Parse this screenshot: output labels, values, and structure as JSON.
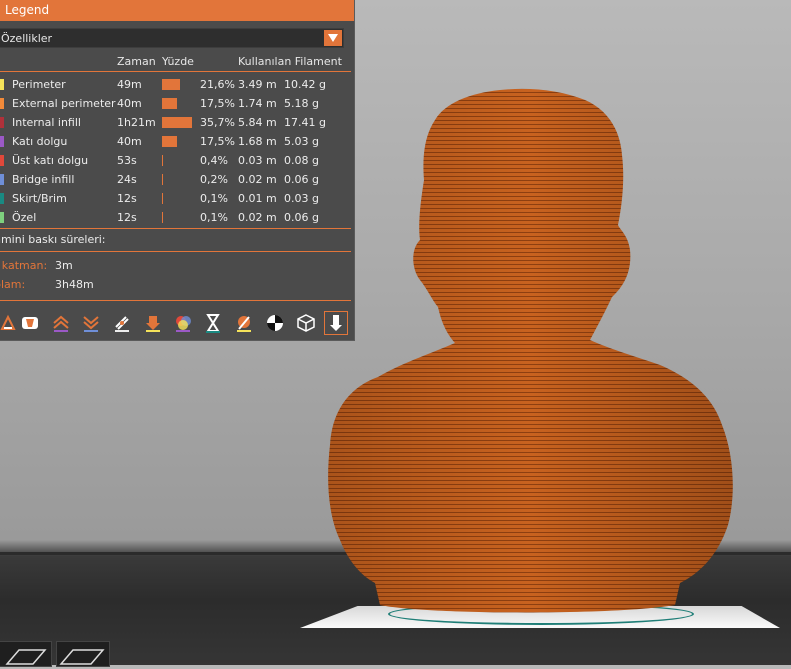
{
  "legend": {
    "title": "Legend",
    "view_type": "Özellikler",
    "headers": {
      "time": "Zaman",
      "percent": "Yüzde",
      "filament": "Kullanılan Filament"
    },
    "rows": [
      {
        "name": "Perimeter",
        "time": "49m",
        "percent": "21,6%",
        "length": "3.49 m",
        "weight": "10.42 g",
        "color": "#f5e35a",
        "fraction": 0.216
      },
      {
        "name": "External perimeter",
        "time": "40m",
        "percent": "17,5%",
        "length": "1.74 m",
        "weight": "5.18 g",
        "color": "#f28a3a",
        "fraction": 0.175
      },
      {
        "name": "Internal infill",
        "time": "1h21m",
        "percent": "35,7%",
        "length": "5.84 m",
        "weight": "17.41 g",
        "color": "#b0313a",
        "fraction": 0.357
      },
      {
        "name": "Katı dolgu",
        "time": "40m",
        "percent": "17,5%",
        "length": "1.68 m",
        "weight": "5.03 g",
        "color": "#9b59c6",
        "fraction": 0.175
      },
      {
        "name": "Üst katı dolgu",
        "time": "53s",
        "percent": "0,4%",
        "length": "0.03 m",
        "weight": "0.08 g",
        "color": "#e0483a",
        "fraction": 0.004
      },
      {
        "name": "Bridge infill",
        "time": "24s",
        "percent": "0,2%",
        "length": "0.02 m",
        "weight": "0.06 g",
        "color": "#6f8fd8",
        "fraction": 0.002
      },
      {
        "name": "Skirt/Brim",
        "time": "12s",
        "percent": "0,1%",
        "length": "0.01 m",
        "weight": "0.03 g",
        "color": "#1a8a82",
        "fraction": 0.001
      },
      {
        "name": "Özel",
        "time": "12s",
        "percent": "0,1%",
        "length": "0.02 m",
        "weight": "0.06 g",
        "color": "#7ed07e",
        "fraction": 0.001
      }
    ],
    "estimate": {
      "title": "hmini baskı süreleri:",
      "first_layer_label": "t katman:",
      "first_layer_value": "3m",
      "total_label": "plam:",
      "total_value": "3h48m"
    },
    "toolbar": [
      {
        "name": "travel-icon"
      },
      {
        "name": "wipe-icon"
      },
      {
        "name": "retractions-icon"
      },
      {
        "name": "deretractions-icon"
      },
      {
        "name": "seams-icon"
      },
      {
        "name": "tool-changes-icon"
      },
      {
        "name": "color-changes-icon"
      },
      {
        "name": "pause-prints-icon"
      },
      {
        "name": "custom-gcodes-icon"
      },
      {
        "name": "center-of-gravity-icon"
      },
      {
        "name": "shells-icon"
      },
      {
        "name": "tool-marker-icon"
      }
    ]
  },
  "colors": {
    "accent": "#e2753a",
    "panel": "#4b4b4b",
    "model": "#c8621f"
  }
}
